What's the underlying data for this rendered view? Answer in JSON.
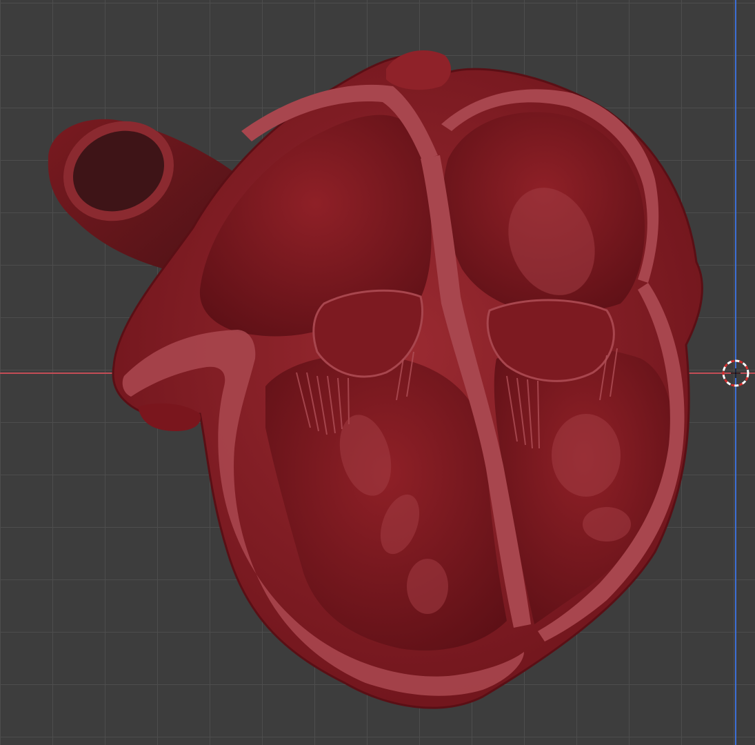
{
  "viewport": {
    "mode": "3d-viewport",
    "background_color": "#3d3d3d",
    "grid_color": "#4d4d4d",
    "x_axis_color": "#c44d56",
    "y_axis_color": "#3d6fd6",
    "model": {
      "name": "heart-cross-section",
      "shading": "solid",
      "color": "#8b1a22"
    },
    "cursor": {
      "icon": "3d-cursor-icon",
      "colors": [
        "#ffffff",
        "#d32f2f"
      ]
    }
  }
}
